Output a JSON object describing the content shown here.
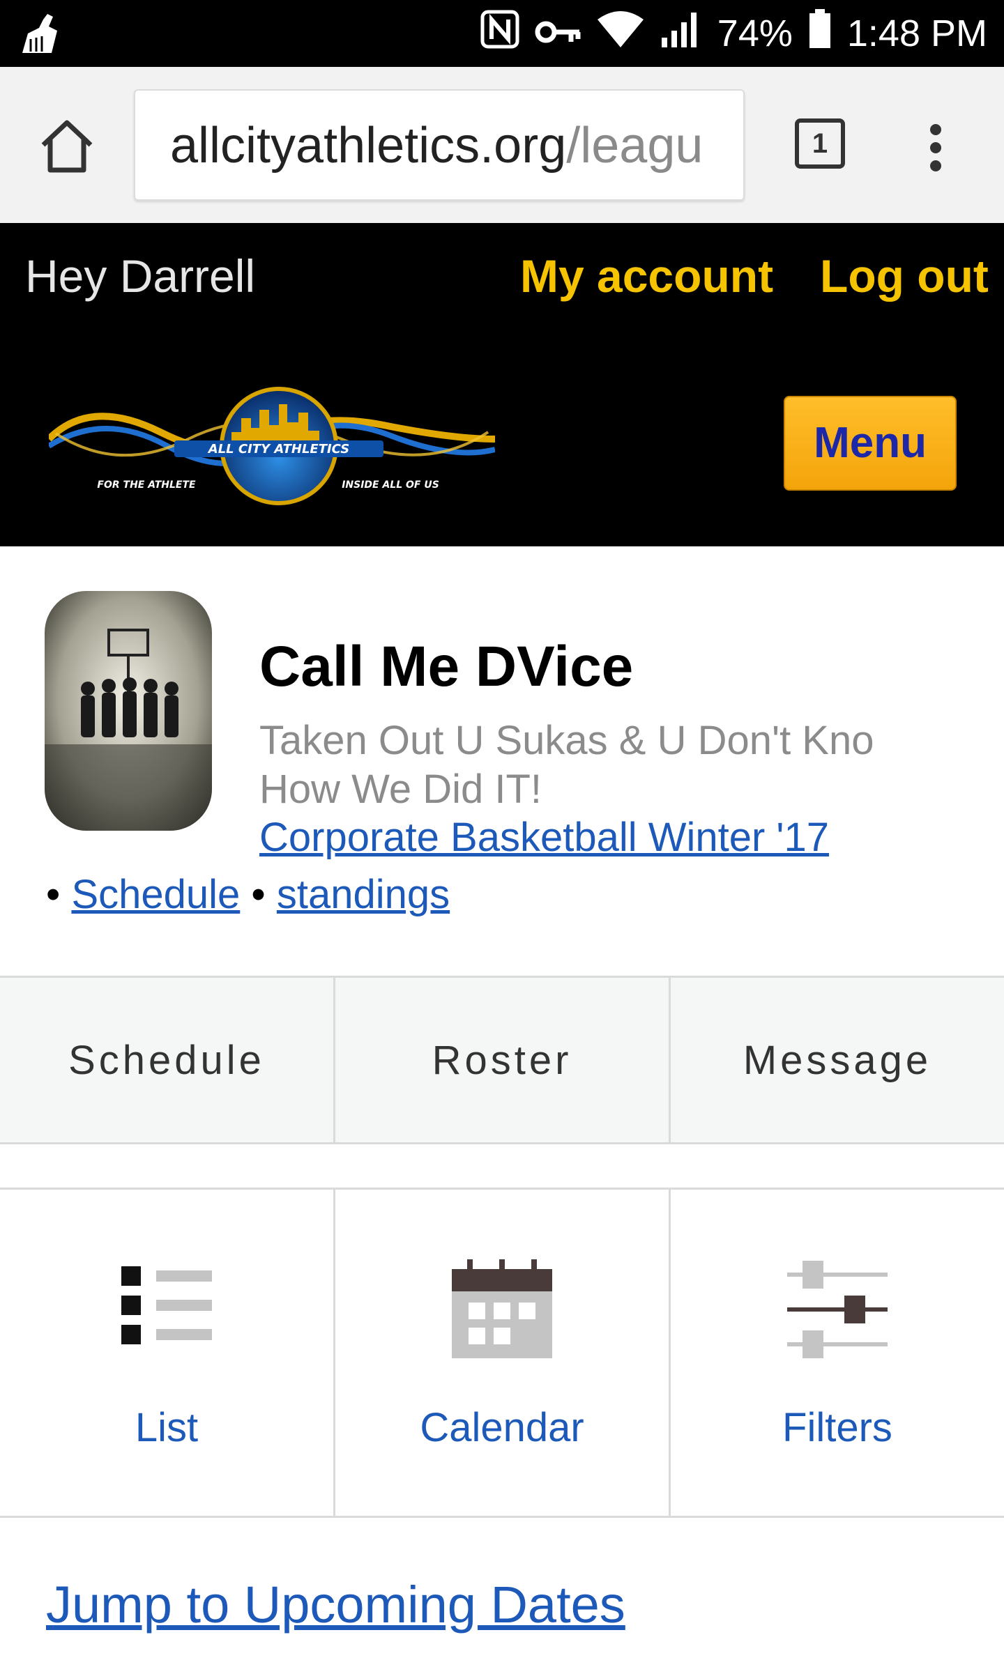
{
  "status_bar": {
    "battery": "74%",
    "time": "1:48 PM",
    "icons": [
      "cleaner-icon",
      "nfc-icon",
      "key-icon",
      "wifi-icon",
      "signal-icon",
      "battery-icon"
    ]
  },
  "browser": {
    "url_domain": "allcityathletics.org",
    "url_path": "/leagu",
    "tab_count": "1"
  },
  "header": {
    "greeting": "Hey Darrell",
    "my_account": "My account",
    "log_out": "Log out",
    "menu": "Menu",
    "logo": {
      "name": "ALL CITY ATHLETICS",
      "left_tagline": "FOR THE ATHLETE",
      "right_tagline": "INSIDE ALL OF US"
    }
  },
  "team": {
    "name": "Call Me DVice",
    "motto": "Taken Out U Sukas & U Don't Kno How We Did IT!",
    "league": "Corporate Basketball Winter '17",
    "links": [
      "Schedule",
      "standings"
    ],
    "bullet": "•"
  },
  "main_tabs": [
    "Schedule",
    "Roster",
    "Message"
  ],
  "view_tabs": [
    "List",
    "Calendar",
    "Filters"
  ],
  "jump_link": "Jump to Upcoming Dates",
  "colors": {
    "accent_yellow": "#f6c300",
    "link_blue": "#1c59b8",
    "menu_button": "#f4a40b"
  }
}
